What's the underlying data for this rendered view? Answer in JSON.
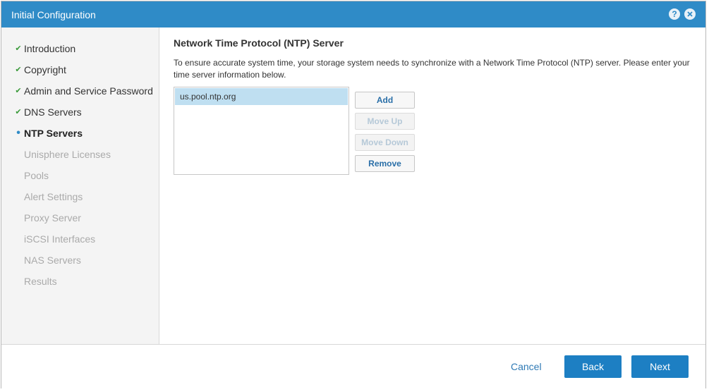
{
  "dialog": {
    "title": "Initial Configuration"
  },
  "titlebar_icons": {
    "help": "?",
    "close": "close-icon"
  },
  "sidebar": {
    "steps": [
      {
        "label": "Introduction",
        "state": "done"
      },
      {
        "label": "Copyright",
        "state": "done"
      },
      {
        "label": "Admin and Service Password",
        "state": "done"
      },
      {
        "label": "DNS Servers",
        "state": "done"
      },
      {
        "label": "NTP Servers",
        "state": "active"
      },
      {
        "label": "Unisphere Licenses",
        "state": "pending"
      },
      {
        "label": "Pools",
        "state": "pending"
      },
      {
        "label": "Alert Settings",
        "state": "pending"
      },
      {
        "label": "Proxy Server",
        "state": "pending"
      },
      {
        "label": "iSCSI Interfaces",
        "state": "pending"
      },
      {
        "label": "NAS Servers",
        "state": "pending"
      },
      {
        "label": "Results",
        "state": "pending"
      }
    ]
  },
  "main": {
    "heading": "Network Time Protocol (NTP) Server",
    "description": "To ensure accurate system time, your storage system needs to synchronize with a Network Time Protocol (NTP) server. Please enter your time server information below.",
    "servers": [
      "us.pool.ntp.org"
    ],
    "buttons": {
      "add": "Add",
      "move_up": "Move Up",
      "move_down": "Move Down",
      "remove": "Remove"
    }
  },
  "footer": {
    "cancel": "Cancel",
    "back": "Back",
    "next": "Next"
  },
  "colors": {
    "titlebar": "#2f8bc7",
    "done_check": "#3a9a3a",
    "primary_button": "#1d7fc3"
  }
}
